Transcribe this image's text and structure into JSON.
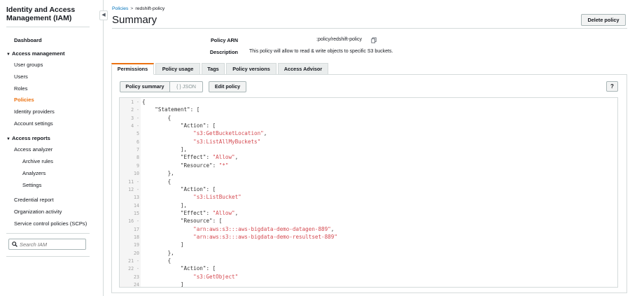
{
  "sidebar": {
    "title": "Identity and Access Management (IAM)",
    "collapse_glyph": "◀",
    "dashboard": "Dashboard",
    "access_management": {
      "label": "Access management",
      "items": [
        "User groups",
        "Users",
        "Roles",
        "Policies",
        "Identity providers",
        "Account settings"
      ],
      "active": "Policies"
    },
    "access_reports": {
      "label": "Access reports",
      "analyzer": "Access analyzer",
      "analyzer_items": [
        "Archive rules",
        "Analyzers",
        "Settings"
      ],
      "items": [
        "Credential report",
        "Organization activity",
        "Service control policies (SCPs)"
      ]
    },
    "search_placeholder": "Search IAM"
  },
  "breadcrumb": {
    "parent": "Policies",
    "separator": ">",
    "current": "redshift-policy"
  },
  "page_title": "Summary",
  "delete_button": "Delete policy",
  "summary": {
    "arn_label": "Policy ARN",
    "arn_value": ":policy/redshift-policy",
    "description_label": "Description",
    "description_value": "This policy will allow to read & write objects to specific S3 buckets."
  },
  "tabs": [
    "Permissions",
    "Policy usage",
    "Tags",
    "Policy versions",
    "Access Advisor"
  ],
  "active_tab": "Permissions",
  "toolbar": {
    "policy_summary": "Policy summary",
    "json": "{ } JSON",
    "edit_policy": "Edit policy",
    "help": "?"
  },
  "editor": {
    "line_numbers": [
      "1 -",
      "2 -",
      "3 -",
      "4 -",
      "5",
      "6",
      "7",
      "8",
      "9",
      "10",
      "11 -",
      "12 -",
      "13",
      "14",
      "15",
      "16 -",
      "17",
      "18",
      "19",
      "20",
      "21 -",
      "22 -",
      "23",
      "24"
    ],
    "lines": [
      "{",
      "    \"Statement\": [",
      "        {",
      "            \"Action\": [",
      "                \"s3:GetBucketLocation\",",
      "                \"s3:ListAllMyBuckets\"",
      "            ],",
      "            \"Effect\": \"Allow\",",
      "            \"Resource\": \"*\"",
      "        },",
      "        {",
      "            \"Action\": [",
      "                \"s3:ListBucket\"",
      "            ],",
      "            \"Effect\": \"Allow\",",
      "            \"Resource\": [",
      "                \"arn:aws:s3:::aws-bigdata-demo-datagen-889\",",
      "                \"arn:aws:s3:::aws-bigdata-demo-resultset-889\"",
      "            ]",
      "        },",
      "        {",
      "            \"Action\": [",
      "                \"s3:GetObject\"",
      "            ]"
    ]
  },
  "colors": {
    "accent": "#ec7211",
    "link": "#0073bb",
    "string": "#d44950"
  }
}
